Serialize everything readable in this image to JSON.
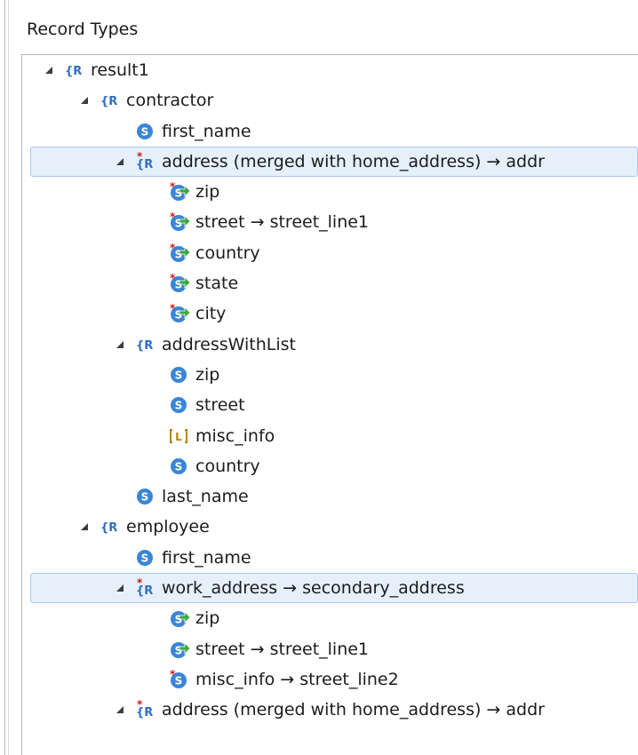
{
  "panel": {
    "title": "Record Types"
  },
  "tree": {
    "result1": {
      "label": "result1"
    },
    "contractor": {
      "label": "contractor"
    },
    "contractor_first_name": {
      "label": "first_name"
    },
    "contractor_address": {
      "label": "address (merged with home_address) → addr"
    },
    "contractor_address_zip": {
      "label": "zip"
    },
    "contractor_address_street": {
      "label": "street → street_line1"
    },
    "contractor_address_country": {
      "label": "country"
    },
    "contractor_address_state": {
      "label": "state"
    },
    "contractor_address_city": {
      "label": "city"
    },
    "contractor_addressWithList": {
      "label": "addressWithList"
    },
    "awl_zip": {
      "label": "zip"
    },
    "awl_street": {
      "label": "street"
    },
    "awl_misc_info": {
      "label": "misc_info"
    },
    "awl_country": {
      "label": "country"
    },
    "contractor_last_name": {
      "label": "last_name"
    },
    "employee": {
      "label": "employee"
    },
    "employee_first_name": {
      "label": "first_name"
    },
    "employee_work_address": {
      "label": "work_address → secondary_address"
    },
    "wa_zip": {
      "label": "zip"
    },
    "wa_street": {
      "label": "street → street_line1"
    },
    "wa_misc_info": {
      "label": "misc_info → street_line2"
    },
    "employee_address": {
      "label": "address (merged with home_address) → addr"
    }
  },
  "icons": {
    "record": "record-type-icon",
    "string": "string-field-icon",
    "list": "list-field-icon",
    "modified_record": "modified-record-icon",
    "mapped_string": "mapped-string-field-icon",
    "modified_string": "modified-string-field-icon"
  },
  "colors": {
    "record": "#2f6fc1",
    "string": "#3a86d6",
    "list": "#b8860b",
    "change_marker": "#d01818",
    "mapped_arrow": "#3aa83a",
    "selection": "#e5f0fb"
  }
}
